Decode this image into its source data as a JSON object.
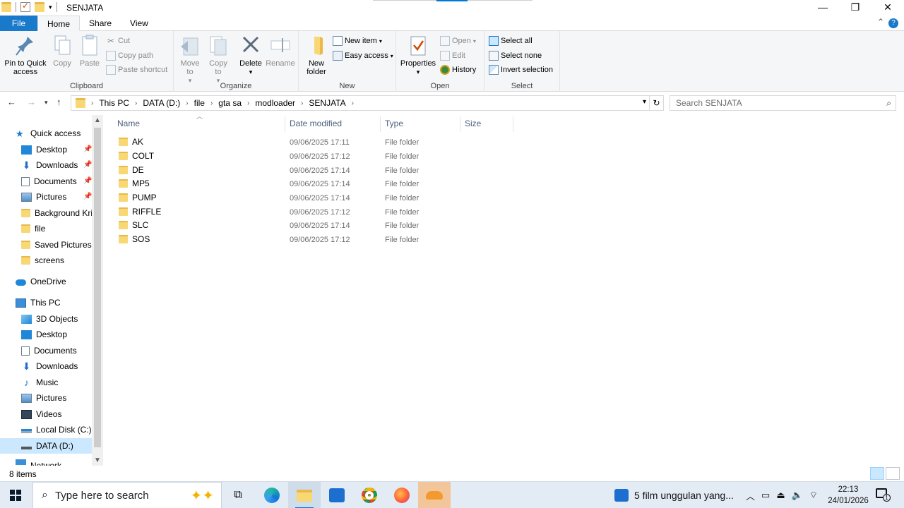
{
  "window": {
    "title": "SENJATA",
    "controls": {
      "minimize": "—",
      "maximize": "❐",
      "close": "✕"
    }
  },
  "ribbon_tabs": [
    {
      "label": "File"
    },
    {
      "label": "Home"
    },
    {
      "label": "Share"
    },
    {
      "label": "View"
    }
  ],
  "ribbon": {
    "clipboard": {
      "label": "Clipboard",
      "pin": "Pin to Quick access",
      "copy": "Copy",
      "paste": "Paste",
      "cut": "Cut",
      "copy_path": "Copy path",
      "paste_shortcut": "Paste shortcut"
    },
    "organize": {
      "label": "Organize",
      "move_to": "Move to",
      "copy_to": "Copy to",
      "delete": "Delete",
      "rename": "Rename"
    },
    "new": {
      "label": "New",
      "new_folder": "New folder",
      "new_item": "New item",
      "easy_access": "Easy access"
    },
    "open": {
      "label": "Open",
      "properties": "Properties",
      "open": "Open",
      "edit": "Edit",
      "history": "History"
    },
    "select": {
      "label": "Select",
      "select_all": "Select all",
      "select_none": "Select none",
      "invert_selection": "Invert selection"
    }
  },
  "address": {
    "crumbs": [
      "This PC",
      "DATA (D:)",
      "file",
      "gta sa",
      "modloader",
      "SENJATA"
    ],
    "search_placeholder": "Search SENJATA"
  },
  "nav_pane": {
    "quick_access": "Quick access",
    "quick_items": [
      "Desktop",
      "Downloads",
      "Documents",
      "Pictures",
      "Background Kris",
      "file",
      "Saved Pictures",
      "screens"
    ],
    "onedrive": "OneDrive",
    "this_pc": "This PC",
    "pc_items": [
      "3D Objects",
      "Desktop",
      "Documents",
      "Downloads",
      "Music",
      "Pictures",
      "Videos",
      "Local Disk (C:)",
      "DATA (D:)"
    ],
    "network": "Network"
  },
  "columns": {
    "name": "Name",
    "date": "Date modified",
    "type": "Type",
    "size": "Size"
  },
  "files": [
    {
      "name": "AK",
      "date": "09/06/2025 17:11",
      "type": "File folder"
    },
    {
      "name": "COLT",
      "date": "09/06/2025 17:12",
      "type": "File folder"
    },
    {
      "name": "DE",
      "date": "09/06/2025 17:14",
      "type": "File folder"
    },
    {
      "name": "MP5",
      "date": "09/06/2025 17:14",
      "type": "File folder"
    },
    {
      "name": "PUMP",
      "date": "09/06/2025 17:14",
      "type": "File folder"
    },
    {
      "name": "RIFFLE",
      "date": "09/06/2025 17:12",
      "type": "File folder"
    },
    {
      "name": "SLC",
      "date": "09/06/2025 17:14",
      "type": "File folder"
    },
    {
      "name": "SOS",
      "date": "09/06/2025 17:12",
      "type": "File folder"
    }
  ],
  "status": {
    "count": "8 items"
  },
  "taskbar": {
    "search_placeholder": "Type here to search",
    "news": "5 film unggulan yang...",
    "time": "22:13",
    "date": "24/01/2026",
    "notif_count": "1"
  },
  "colors": {
    "accent": "#0078d7",
    "file_tab": "#1979ca",
    "folder": "#f8d775",
    "selection": "#cce8ff",
    "taskbar": "#e3ebf4"
  }
}
